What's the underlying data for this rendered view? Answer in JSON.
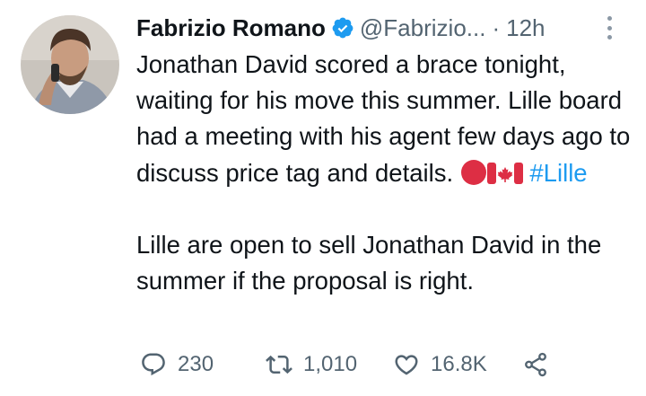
{
  "author": {
    "name": "Fabrizio Romano",
    "handle": "@Fabrizio...",
    "separator": "·",
    "time": "12h",
    "verified": true
  },
  "tweet": {
    "paragraph1": "Jonathan David scored a brace tonight, waiting for his move this summer. Lille board had a meeting with his agent few days ago to discuss price tag and details.",
    "emojis": [
      "red-circle-icon",
      "canada-flag-icon"
    ],
    "hashtag": "#Lille",
    "paragraph2": "Lille are open to sell Jonathan David in the summer if the proposal is right."
  },
  "actions": {
    "replies": "230",
    "retweets": "1,010",
    "likes": "16.8K"
  },
  "colors": {
    "text": "#0f1419",
    "secondary": "#536471",
    "link": "#1d9bf0",
    "verified": "#1d9bf0"
  }
}
